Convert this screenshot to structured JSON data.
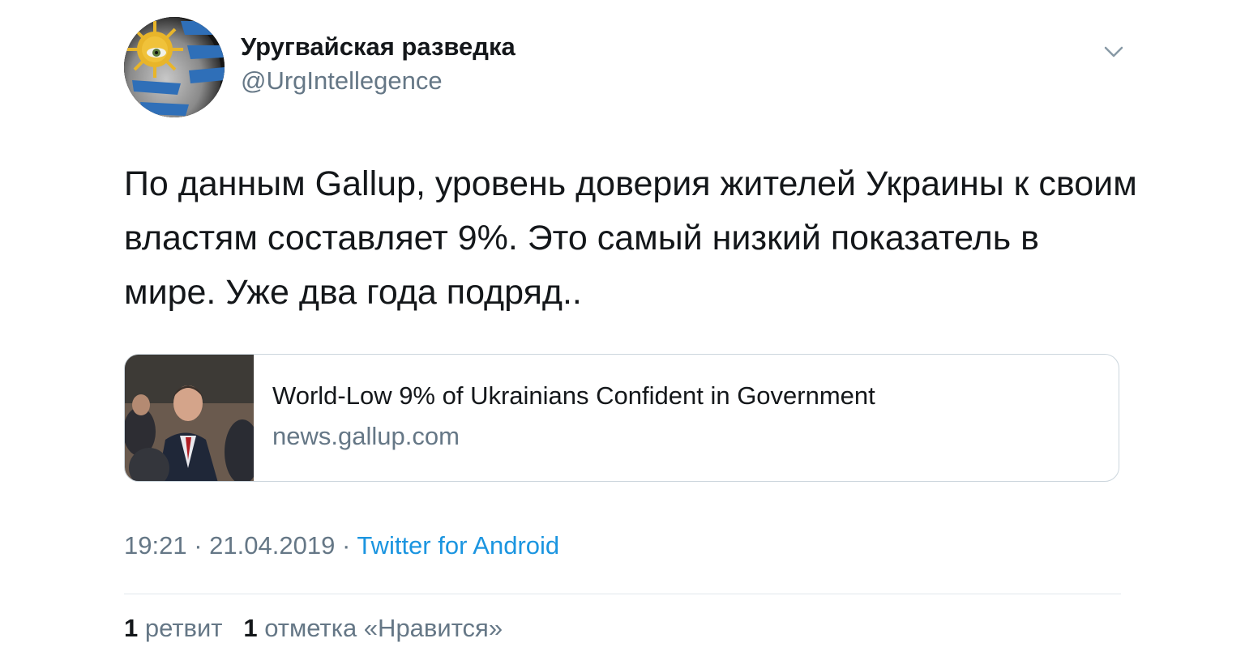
{
  "author": {
    "display_name": "Уругвайская разведка",
    "handle": "@UrgIntellegence"
  },
  "tweet": {
    "text": "По данным Gallup, уровень доверия жителей Украины к своим властям составляет 9%. Это самый низкий показатель в мире. Уже два года подряд.."
  },
  "card": {
    "title": "World-Low 9% of Ukrainians Confident in Government",
    "domain": "news.gallup.com"
  },
  "meta": {
    "time": "19:21",
    "separator": "·",
    "date": "21.04.2019",
    "source": "Twitter for Android"
  },
  "stats": {
    "retweet_count": "1",
    "retweet_label": "ретвит",
    "like_count": "1",
    "like_label": "отметка «Нравится»"
  },
  "colors": {
    "text_primary": "#14171a",
    "text_secondary": "#657786",
    "link": "#1b95e0",
    "border": "#ccd6dd"
  },
  "icons": {
    "caret": "chevron-down-icon"
  }
}
